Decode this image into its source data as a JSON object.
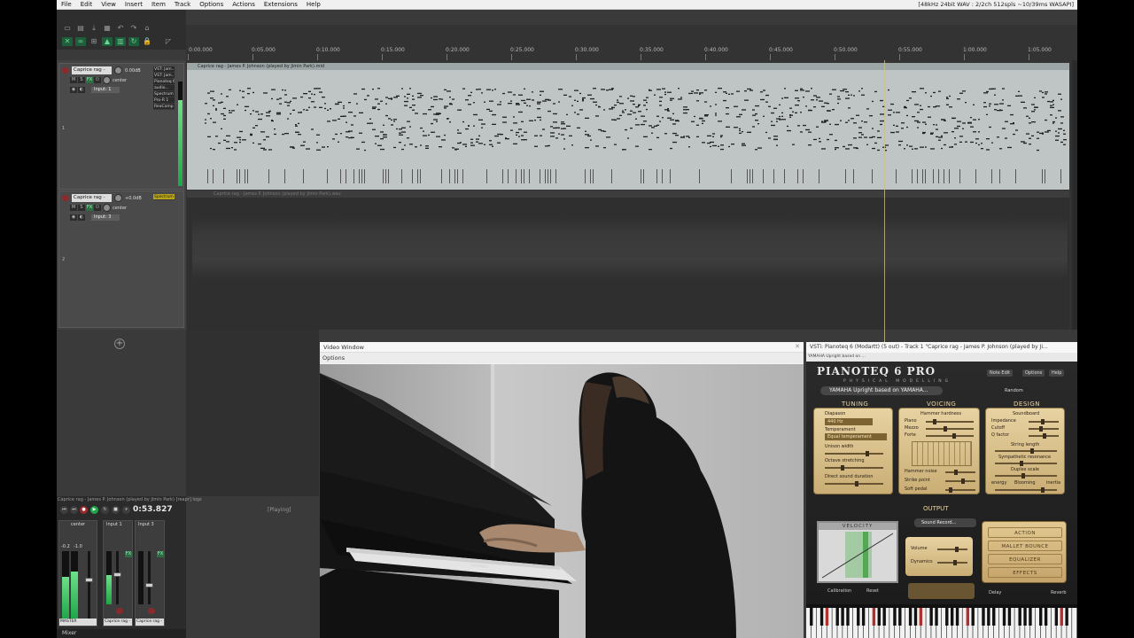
{
  "menubar": {
    "items": [
      "File",
      "Edit",
      "View",
      "Insert",
      "Item",
      "Track",
      "Options",
      "Actions",
      "Extensions",
      "Help"
    ],
    "audio_status": "[48kHz 24bit WAV : 2/2ch 512spls ~10/39ms WASAPI]"
  },
  "ruler": {
    "labels": [
      "0:00.000",
      "0:05.000",
      "0:10.000",
      "0:15.000",
      "0:20.000",
      "0:25.000",
      "0:30.000",
      "0:35.000",
      "0:40.000",
      "0:45.000",
      "0:50.000",
      "0:55.000",
      "1:00.000",
      "1:05.000"
    ]
  },
  "tracks": [
    {
      "name": "Caprice rag - ",
      "volume": "0.00dB",
      "pan": "center",
      "input": "Input: 1",
      "number": "1",
      "fx": [
        "VST: Jam...",
        "VST: Jam...",
        "Pianoteq 6",
        "audio...",
        "Spectrum A",
        "Pro-R 1",
        "ReaComp"
      ]
    },
    {
      "name": "Caprice rag - ",
      "volume": "+0.0dB",
      "pan": "center",
      "input": "Input: 3",
      "number": "2",
      "fx": [
        "Spectrum A"
      ]
    }
  ],
  "items": {
    "midi_title": "Caprice rag - James P. Johnson (played by Jimin Park).mid",
    "audio_title": "Caprice rag - James P. Johnson (played by Jimin Park).wav"
  },
  "transport": {
    "title": "Caprice rag - James P. Johnson (played by Jimin Park) [reapr] logs",
    "time": "0:53.827",
    "state": "[Playing]"
  },
  "mixer": {
    "master_label": "MASTER",
    "tab_label": "Mixer",
    "master_rms": "RMS -0.4",
    "master_values": [
      "-0.2",
      "-1.0"
    ],
    "strip1_label": "Caprice rag -",
    "strip2_label": "Caprice rag -",
    "strip1_input": "Input 1",
    "strip2_input": "Input 3",
    "center_label": "center"
  },
  "video": {
    "title": "Video Window",
    "options": "Options"
  },
  "vst": {
    "title": "VSTi: Pianoteq 6 (Modartt) (5 out) - Track 1 \"Caprice rag - James P. Johnson (played by Ji...",
    "subbar": "YAMAHA Upright based on ...",
    "logo": "PIANOTEQ 6 PRO",
    "logo_sub": "PHYSICAL MODELLING",
    "preset": "YAMAHA Upright based on YAMAHA...",
    "top_buttons": [
      "Note Edit",
      "Options",
      "Help"
    ],
    "random": "Random",
    "sections": [
      "TUNING",
      "VOICING",
      "DESIGN"
    ],
    "tuning": {
      "diapason_label": "Diapason",
      "diapason_value": "440 Hz",
      "temperament_label": "Temperament",
      "temperament_value": "Equal temperament",
      "unison_width": "Unison width",
      "octave_stretching": "Octave stretching",
      "direct_sound_duration": "Direct sound duration"
    },
    "voicing": {
      "hammer_hardness": "Hammer hardness",
      "piano": "Piano",
      "mezzo": "Mezzo",
      "forte": "Forte",
      "hammer_noise": "Hammer noise",
      "strike_point": "Strike point",
      "soft_pedal": "Soft pedal"
    },
    "design": {
      "soundboard": "Soundboard",
      "impedance": "Impedance",
      "cutoff": "Cutoff",
      "q_factor": "Q factor",
      "string_length": "String length",
      "sympathetic_resonance": "Sympathetic resonance",
      "duplex_scale": "Duplex scale",
      "energy": "energy",
      "blooming": "Blooming",
      "inertia": "inertia"
    },
    "output_title": "OUTPUT",
    "sound_recording": "Sound Record...",
    "velocity_title": "VELOCITY",
    "calibration": "Calibration",
    "reset": "Reset",
    "volume": "Volume",
    "dynamics": "Dynamics",
    "actions": [
      "ACTION",
      "MALLET BOUNCE",
      "EQUALIZER",
      "EFFECTS"
    ],
    "delay": "Delay",
    "reverb": "Reverb"
  },
  "colors": {
    "accent_green": "#1fa64a",
    "midi_item_bg": "#bfc5c5",
    "pianoteq_panel": "#e8d2a2",
    "record_red": "#9a2b2b"
  },
  "meters": {
    "track1_level": 0.82,
    "master_left": 0.62,
    "master_right": 0.7,
    "strip1_level": 0.55
  }
}
